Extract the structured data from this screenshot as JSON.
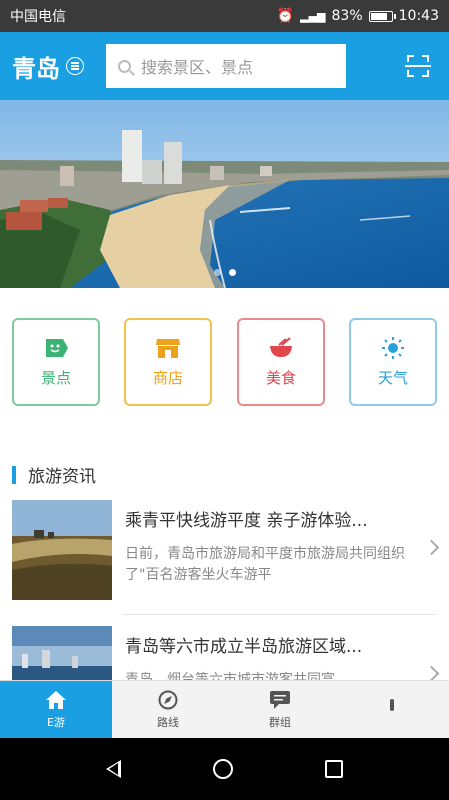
{
  "status_bar": {
    "carrier": "中国电信",
    "battery_percent": "83%",
    "battery_level": 0.83,
    "time": "10:43"
  },
  "header": {
    "city": "青岛",
    "search_placeholder": "搜索景区、景点"
  },
  "banner": {
    "slide_count": 2,
    "active_slide": 1
  },
  "categories": [
    {
      "label": "景点",
      "icon": "tag-icon",
      "color": "#3bb374"
    },
    {
      "label": "商店",
      "icon": "shop-icon",
      "color": "#eca21a"
    },
    {
      "label": "美食",
      "icon": "food-icon",
      "color": "#e0464b"
    },
    {
      "label": "天气",
      "icon": "sun-icon",
      "color": "#27a2dc"
    }
  ],
  "section": {
    "title": "旅游资讯"
  },
  "news": [
    {
      "title": "乘青平快线游平度 亲子游体验...",
      "description": "日前，青岛市旅游局和平度市旅游局共同组织了\"百名游客坐火车游平"
    },
    {
      "title": "青岛等六市成立半岛旅游区域...",
      "description": "青岛、烟台等六市城市游客共同富"
    }
  ],
  "tabs": [
    {
      "label": "E游",
      "icon": "home-icon",
      "active": true
    },
    {
      "label": "路线",
      "icon": "compass-icon",
      "active": false
    },
    {
      "label": "群组",
      "icon": "chat-icon",
      "active": false
    },
    {
      "label": "",
      "icon": "person-icon",
      "active": false
    }
  ],
  "colors": {
    "primary": "#1a9fe3",
    "status_bar": "#3a3a3a"
  }
}
